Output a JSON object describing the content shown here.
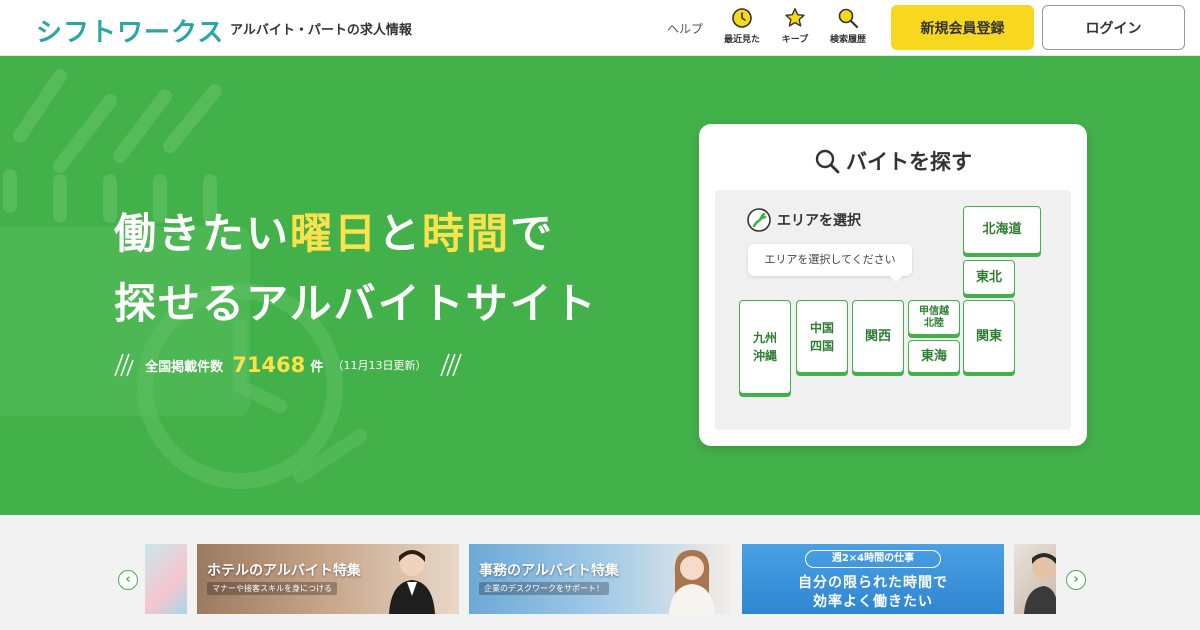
{
  "header": {
    "logo_text": "シフトワークス",
    "tagline": "アルバイト・パートの求人情報",
    "help_label": "ヘルプ",
    "nav": [
      {
        "label": "最近見た",
        "icon": "clock-icon"
      },
      {
        "label": "キープ",
        "icon": "star-icon"
      },
      {
        "label": "検索履歴",
        "icon": "search-history-icon"
      }
    ],
    "register_label": "新規会員登録",
    "login_label": "ログイン"
  },
  "hero": {
    "line1_a": "働きたい",
    "line1_b": "曜日",
    "line1_c": "と",
    "line1_d": "時間",
    "line1_e": "で",
    "line2": "探せるアルバイトサイト",
    "count_label": "全国掲載件数",
    "count_value": "71468",
    "count_unit": "件",
    "updated": "（11月13日更新）"
  },
  "search": {
    "title": "バイトを探す",
    "area_label": "エリアを選択",
    "bubble": "エリアを選択してください",
    "regions": {
      "hokkaido": "北海道",
      "tohoku": "東北",
      "kanto": "関東",
      "koshinetsu_1": "甲信越",
      "koshinetsu_2": "北陸",
      "tokai": "東海",
      "kansai": "関西",
      "chugoku_1": "中国",
      "chugoku_2": "四国",
      "kyushu_1": "九州",
      "kyushu_2": "沖縄"
    }
  },
  "carousel": {
    "prev": "‹",
    "next": "›",
    "slides": [
      {
        "title": "ホテルのアルバイト特集",
        "sub": "マナーや接客スキルを身につける"
      },
      {
        "title": "事務のアルバイト特集",
        "sub": "企業のデスクワークをサポート！"
      },
      {
        "pill": "週2×4時間の仕事",
        "line1": "自分の限られた時間で",
        "line2": "効率よく働きたい"
      }
    ]
  },
  "colors": {
    "brand_green": "#43b14a",
    "accent_yellow": "#fbe14b",
    "register_yellow": "#f7d81f",
    "logo_teal": "#2aa6a4"
  }
}
